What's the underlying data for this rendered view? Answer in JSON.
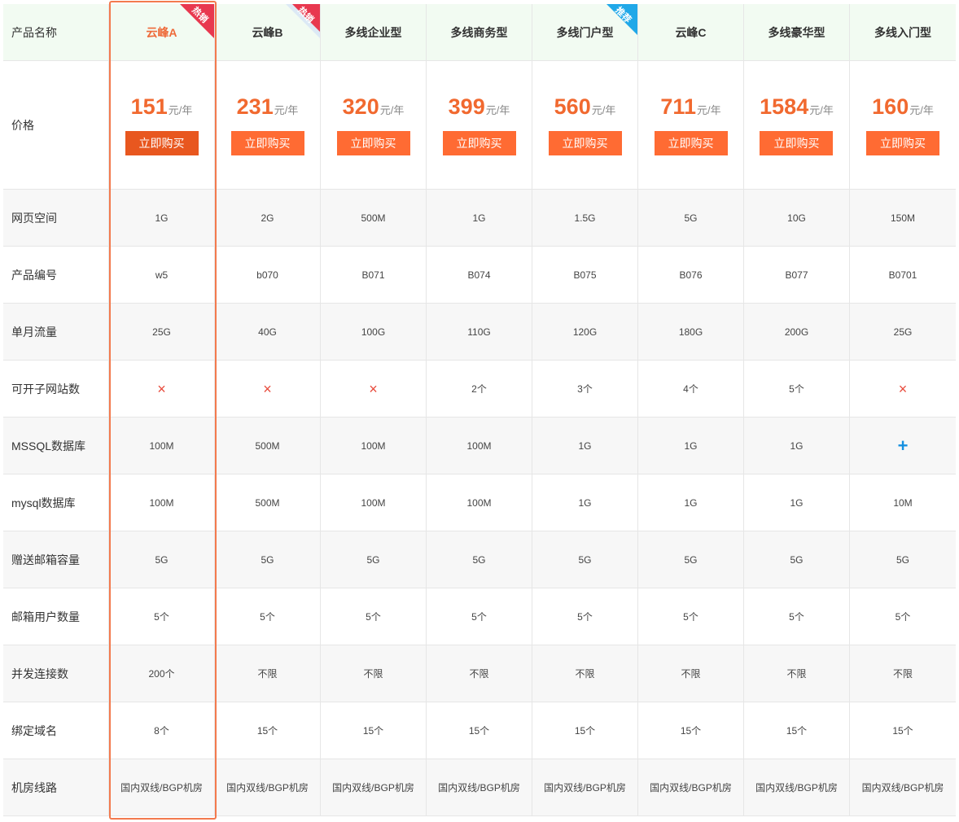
{
  "row_labels": {
    "name": "产品名称",
    "price": "价格",
    "space": "网页空间",
    "code": "产品编号",
    "traffic": "单月流量",
    "sites": "可开子网站数",
    "mssql": "MSSQL数据库",
    "mysql": "mysql数据库",
    "mail_cap": "赠送邮箱容量",
    "mail_users": "邮箱用户数量",
    "concurrency": "并发连接数",
    "domains": "绑定域名",
    "line": "机房线路"
  },
  "price_unit": "元/年",
  "buy_label": "立即购买",
  "ribbons": {
    "hot": "热销",
    "recommend": "推荐"
  },
  "products": [
    {
      "name": "云峰A",
      "ribbon": "hot",
      "price": "151",
      "space": "1G",
      "code": "w5",
      "traffic": "25G",
      "sites": "×",
      "mssql": "100M",
      "mysql": "100M",
      "mail_cap": "5G",
      "mail_users": "5个",
      "concurrency": "200个",
      "domains": "8个",
      "line": "国内双线/BGP机房"
    },
    {
      "name": "云峰B",
      "ribbon": "hot",
      "price": "231",
      "space": "2G",
      "code": "b070",
      "traffic": "40G",
      "sites": "×",
      "mssql": "500M",
      "mysql": "500M",
      "mail_cap": "5G",
      "mail_users": "5个",
      "concurrency": "不限",
      "domains": "15个",
      "line": "国内双线/BGP机房"
    },
    {
      "name": "多线企业型",
      "price": "320",
      "space": "500M",
      "code": "B071",
      "traffic": "100G",
      "sites": "×",
      "mssql": "100M",
      "mysql": "100M",
      "mail_cap": "5G",
      "mail_users": "5个",
      "concurrency": "不限",
      "domains": "15个",
      "line": "国内双线/BGP机房"
    },
    {
      "name": "多线商务型",
      "price": "399",
      "space": "1G",
      "code": "B074",
      "traffic": "110G",
      "sites": "2个",
      "mssql": "100M",
      "mysql": "100M",
      "mail_cap": "5G",
      "mail_users": "5个",
      "concurrency": "不限",
      "domains": "15个",
      "line": "国内双线/BGP机房"
    },
    {
      "name": "多线门户型",
      "ribbon": "recommend",
      "price": "560",
      "space": "1.5G",
      "code": "B075",
      "traffic": "120G",
      "sites": "3个",
      "mssql": "1G",
      "mysql": "1G",
      "mail_cap": "5G",
      "mail_users": "5个",
      "concurrency": "不限",
      "domains": "15个",
      "line": "国内双线/BGP机房"
    },
    {
      "name": "云峰C",
      "price": "711",
      "space": "5G",
      "code": "B076",
      "traffic": "180G",
      "sites": "4个",
      "mssql": "1G",
      "mysql": "1G",
      "mail_cap": "5G",
      "mail_users": "5个",
      "concurrency": "不限",
      "domains": "15个",
      "line": "国内双线/BGP机房"
    },
    {
      "name": "多线豪华型",
      "price": "1584",
      "space": "10G",
      "code": "B077",
      "traffic": "200G",
      "sites": "5个",
      "mssql": "1G",
      "mysql": "1G",
      "mail_cap": "5G",
      "mail_users": "5个",
      "concurrency": "不限",
      "domains": "15个",
      "line": "国内双线/BGP机房"
    },
    {
      "name": "多线入门型",
      "price": "160",
      "space": "150M",
      "code": "B0701",
      "traffic": "25G",
      "sites": "×",
      "mssql": "+",
      "mysql": "10M",
      "mail_cap": "5G",
      "mail_users": "5个",
      "concurrency": "不限",
      "domains": "15个",
      "line": "国内双线/BGP机房"
    }
  ],
  "colors": {
    "accent": "#ff6b33",
    "highlight": "#f37a4e",
    "header_bg": "#f2fbf2",
    "hot_ribbon": "#e8384f",
    "recommend_ribbon": "#20a8e8",
    "cross": "#e84c3d",
    "plus": "#1590e0"
  }
}
